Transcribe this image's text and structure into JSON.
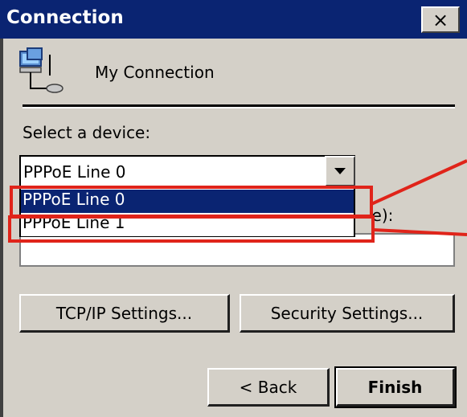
{
  "window": {
    "title": "Connection",
    "close_label": "×"
  },
  "connection": {
    "name": "My Connection",
    "icon": "network-computers-icon"
  },
  "device": {
    "label": "Select a device:",
    "selected": "PPPoE Line 0",
    "options": [
      "PPPoE Line 0",
      "PPPoE Line 1"
    ],
    "behind_label": "ice):"
  },
  "buttons": {
    "tcpip": "TCP/IP Settings...",
    "security": "Security Settings...",
    "back": "< Back",
    "finish": "Finish"
  },
  "colors": {
    "title_bar": "#0a2472",
    "client_bg": "#d4d0c8",
    "selection_bg": "#0a2472",
    "annotation_red": "#e0241a"
  }
}
